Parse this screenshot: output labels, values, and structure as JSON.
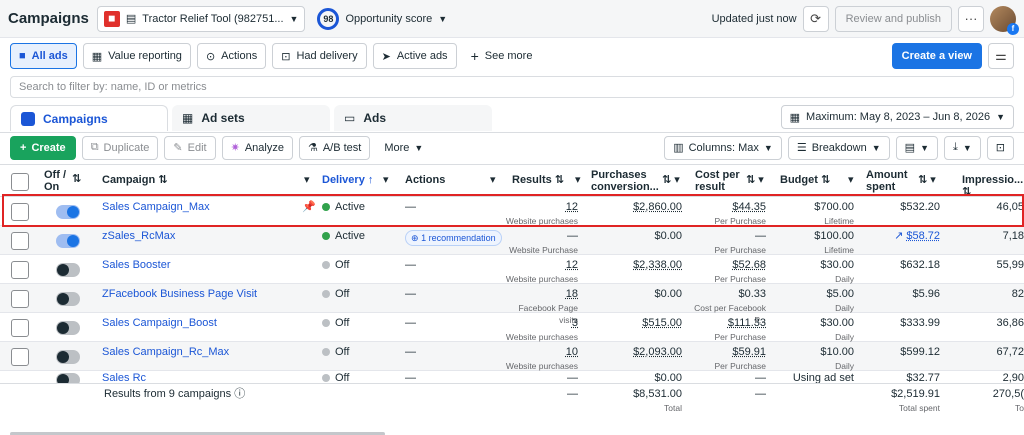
{
  "topbar": {
    "title": "Campaigns",
    "account_name": "Tractor Relief Tool (982751...",
    "opportunity_score_value": "98",
    "opportunity_score_label": "Opportunity score",
    "updated_text": "Updated just now",
    "review_publish_label": "Review and publish",
    "more_label": "···"
  },
  "filters": {
    "all_ads": "All ads",
    "value_reporting": "Value reporting",
    "actions": "Actions",
    "had_delivery": "Had delivery",
    "active_ads": "Active ads",
    "see_more": "See more",
    "create_view": "Create a view"
  },
  "search": {
    "placeholder": "Search to filter by: name, ID or metrics"
  },
  "tabs": {
    "campaigns": "Campaigns",
    "ad_sets": "Ad sets",
    "ads": "Ads",
    "date_range": "Maximum: May 8, 2023 – Jun 8, 2026"
  },
  "toolbar": {
    "create": "Create",
    "duplicate": "Duplicate",
    "edit": "Edit",
    "analyze": "Analyze",
    "ab_test": "A/B test",
    "more": "More",
    "columns": "Columns: Max",
    "breakdown": "Breakdown"
  },
  "table": {
    "headers": {
      "off_on": "Off / On",
      "campaign": "Campaign",
      "delivery": "Delivery",
      "actions": "Actions",
      "results": "Results",
      "purchases_conversion": "Purchases conversion...",
      "cost_per_result": "Cost per result",
      "budget": "Budget",
      "amount_spent": "Amount spent",
      "impressions": "Impressio..."
    },
    "rows": [
      {
        "name": "Sales Campaign_Max",
        "delivery": "Active",
        "actions": "—",
        "results": "12",
        "results_sub": "Website purchases",
        "purchases": "$2,860.00",
        "cost": "$44.35",
        "cost_sub": "Per Purchase",
        "budget": "$700.00",
        "budget_sub": "Lifetime",
        "spent": "$532.20",
        "impressions": "46,05"
      },
      {
        "name": "zSales_RcMax",
        "delivery": "Active",
        "actions": "1 recommendation",
        "results": "—",
        "results_sub": "Website Purchase",
        "purchases": "$0.00",
        "cost": "—",
        "cost_sub": "Per Purchase",
        "budget": "$100.00",
        "budget_sub": "Lifetime",
        "spent": "$58.72",
        "impressions": "7,18"
      },
      {
        "name": "Sales Booster",
        "delivery": "Off",
        "actions": "—",
        "results": "12",
        "results_sub": "Website purchases",
        "purchases": "$2,338.00",
        "cost": "$52.68",
        "cost_sub": "Per Purchase",
        "budget": "$30.00",
        "budget_sub": "Daily",
        "spent": "$632.18",
        "impressions": "55,99"
      },
      {
        "name": "ZFacebook Business Page Visit",
        "delivery": "Off",
        "actions": "—",
        "results": "18",
        "results_sub": "Facebook Page visits",
        "purchases": "$0.00",
        "cost": "$0.33",
        "cost_sub": "Cost per Facebook P...",
        "budget": "$5.00",
        "budget_sub": "Daily",
        "spent": "$5.96",
        "impressions": "82"
      },
      {
        "name": "Sales Campaign_Boost",
        "delivery": "Off",
        "actions": "—",
        "results": "3",
        "results_sub": "Website purchases",
        "purchases": "$515.00",
        "cost": "$111.33",
        "cost_sub": "Per Purchase",
        "budget": "$30.00",
        "budget_sub": "Daily",
        "spent": "$333.99",
        "impressions": "36,86"
      },
      {
        "name": "Sales Campaign_Rc_Max",
        "delivery": "Off",
        "actions": "—",
        "results": "10",
        "results_sub": "Website purchases",
        "purchases": "$2,093.00",
        "cost": "$59.91",
        "cost_sub": "Per Purchase",
        "budget": "$10.00",
        "budget_sub": "Daily",
        "spent": "$599.12",
        "impressions": "67,72"
      },
      {
        "name": "Sales Rc",
        "delivery": "Off",
        "actions": "—",
        "results": "—",
        "results_sub": "",
        "purchases": "$0.00",
        "cost": "—",
        "cost_sub": "",
        "budget": "Using ad set bud...",
        "budget_sub": "",
        "spent": "$32.77",
        "impressions": "2,90"
      }
    ],
    "footer": {
      "label": "Results from 9 campaigns",
      "results": "—",
      "purchases": "$8,531.00",
      "purchases_sub": "Total",
      "cost": "—",
      "spent": "$2,519.91",
      "spent_sub": "Total spent",
      "impressions": "270,5(",
      "impressions_sub": "To"
    }
  }
}
